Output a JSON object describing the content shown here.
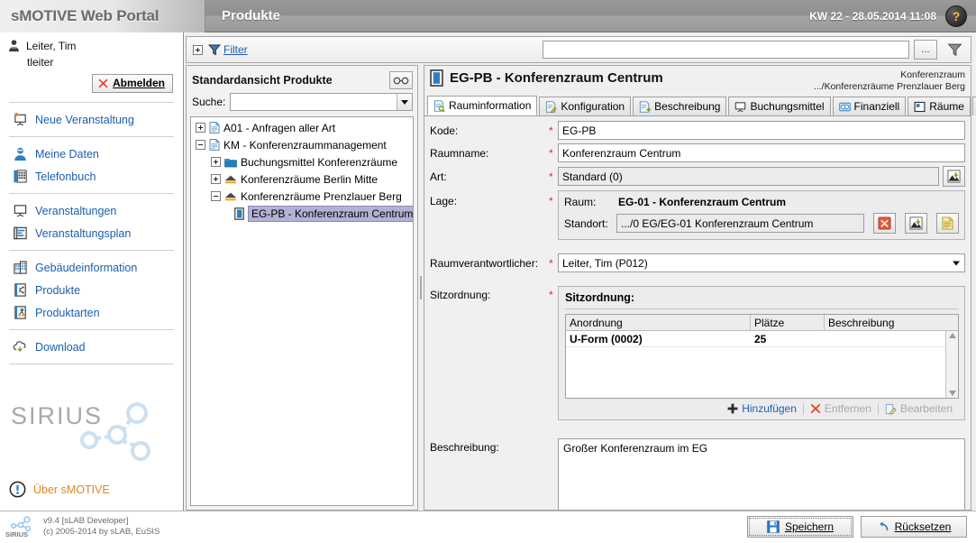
{
  "header": {
    "brand": "sMOTIVE Web Portal",
    "module_title": "Produkte",
    "datetime": "KW 22 - 28.05.2014 11:08",
    "help_glyph": "?"
  },
  "sidebar": {
    "user": {
      "name": "Leiter, Tim",
      "login": "tleiter"
    },
    "logout_label": "Abmelden",
    "nav_groups": [
      {
        "items": [
          {
            "label": "Neue Veranstaltung",
            "icon": "new-presentation-icon"
          }
        ]
      },
      {
        "items": [
          {
            "label": "Meine Daten",
            "icon": "user-icon"
          },
          {
            "label": "Telefonbuch",
            "icon": "phonebook-icon"
          }
        ]
      },
      {
        "items": [
          {
            "label": "Veranstaltungen",
            "icon": "presentation-icon"
          },
          {
            "label": "Veranstaltungsplan",
            "icon": "plan-icon"
          }
        ]
      },
      {
        "items": [
          {
            "label": "Gebäudeinformation",
            "icon": "building-icon"
          },
          {
            "label": "Produkte",
            "icon": "product-icon"
          },
          {
            "label": "Produktarten",
            "icon": "product-types-icon"
          }
        ]
      },
      {
        "items": [
          {
            "label": "Download",
            "icon": "download-cloud-icon"
          }
        ]
      }
    ],
    "logo_text": "SIRIUS",
    "about_label": "Über sMOTIVE"
  },
  "footer": {
    "version": "v9.4 [sLAB Developer]",
    "copyright": "(c) 2005-2014 by sLAB, EuSIS",
    "logo_text": "SIRIUS",
    "save_label": "Speichern",
    "reset_label": "Rücksetzen"
  },
  "filterbar": {
    "filter_label": "Filter",
    "input_value": "",
    "ellipsis_label": "...",
    "funnel_icon": "funnel-icon"
  },
  "tree": {
    "title": "Standardansicht Produkte",
    "glasses_icon": "glasses-icon",
    "search_label": "Suche:",
    "search_value": "",
    "nodes": [
      {
        "label": "A01 - Anfragen aller Art",
        "indent": 0,
        "toggle": "plus",
        "icon": "document-icon",
        "selected": false
      },
      {
        "label": "KM - Konferenzraummanagement",
        "indent": 0,
        "toggle": "minus",
        "icon": "document-icon",
        "selected": false
      },
      {
        "label": "Buchungsmittel Konferenzräume",
        "indent": 1,
        "toggle": "plus",
        "icon": "folder-icon",
        "selected": false
      },
      {
        "label": "Konferenzräume Berlin Mitte",
        "indent": 1,
        "toggle": "plus",
        "icon": "house-icon",
        "selected": false
      },
      {
        "label": "Konferenzräume Prenzlauer Berg",
        "indent": 1,
        "toggle": "minus",
        "icon": "house-icon",
        "selected": false
      },
      {
        "label": "EG-PB - Konferenzraum Centrum",
        "indent": 2,
        "toggle": "none",
        "icon": "door-icon",
        "selected": true
      }
    ]
  },
  "detail": {
    "title": "EG-PB - Konferenzraum Centrum",
    "title_icon": "door-icon",
    "breadcrumb_line1": "Konferenzraum",
    "breadcrumb_line2": ".../Konferenzräume Prenzlauer Berg",
    "tabs": [
      {
        "label": "Rauminformation",
        "icon": "room-info-icon",
        "active": true
      },
      {
        "label": "Konfiguration",
        "icon": "config-icon",
        "active": false
      },
      {
        "label": "Beschreibung",
        "icon": "description-icon",
        "active": false
      },
      {
        "label": "Buchungsmittel",
        "icon": "booking-icon",
        "active": false
      },
      {
        "label": "Finanziell",
        "icon": "financial-icon",
        "active": false
      },
      {
        "label": "Räume",
        "icon": "rooms-icon",
        "active": false
      },
      {
        "label": "",
        "icon": "more-icon",
        "active": false
      }
    ],
    "form": {
      "kode": {
        "label": "Kode:",
        "value": "EG-PB",
        "required": true
      },
      "raumname": {
        "label": "Raumname:",
        "value": "Konferenzraum Centrum",
        "required": true
      },
      "art": {
        "label": "Art:",
        "value": "Standard (0)",
        "required": true,
        "button_icon": "pick-icon"
      },
      "lage": {
        "label": "Lage:",
        "required": true,
        "raum_label": "Raum:",
        "raum_value": "EG-01 - Konferenzraum Centrum",
        "standort_label": "Standort:",
        "standort_value": ".../0 EG/EG-01 Konferenzraum Centrum",
        "buttons": [
          {
            "icon": "clear-red-x-icon"
          },
          {
            "icon": "pick-icon"
          },
          {
            "icon": "note-icon"
          }
        ]
      },
      "raumverantwortlicher": {
        "label": "Raumverantwortlicher:",
        "value": "Leiter, Tim (P012)",
        "required": true
      },
      "sitzordnung": {
        "label": "Sitzordnung:",
        "required": true,
        "group_title": "Sitzordnung:",
        "columns": [
          "Anordnung",
          "Plätze",
          "Beschreibung"
        ],
        "rows": [
          {
            "anordnung": "U-Form (0002)",
            "plaetze": "25",
            "beschreibung": ""
          }
        ],
        "actions": [
          {
            "label": "Hinzufügen",
            "icon": "plus-icon",
            "enabled": true
          },
          {
            "label": "Entfernen",
            "icon": "red-x-icon",
            "enabled": false
          },
          {
            "label": "Bearbeiten",
            "icon": "edit-icon",
            "enabled": false
          }
        ]
      },
      "beschreibung": {
        "label": "Beschreibung:",
        "value": "Großer Konferenzraum im EG"
      }
    }
  },
  "colors": {
    "link": "#1b5faa",
    "required_star": "#d62e2e",
    "about_orange": "#d98a23",
    "selection": "#b2b2d6",
    "header_bar": "#9a9a9a"
  }
}
